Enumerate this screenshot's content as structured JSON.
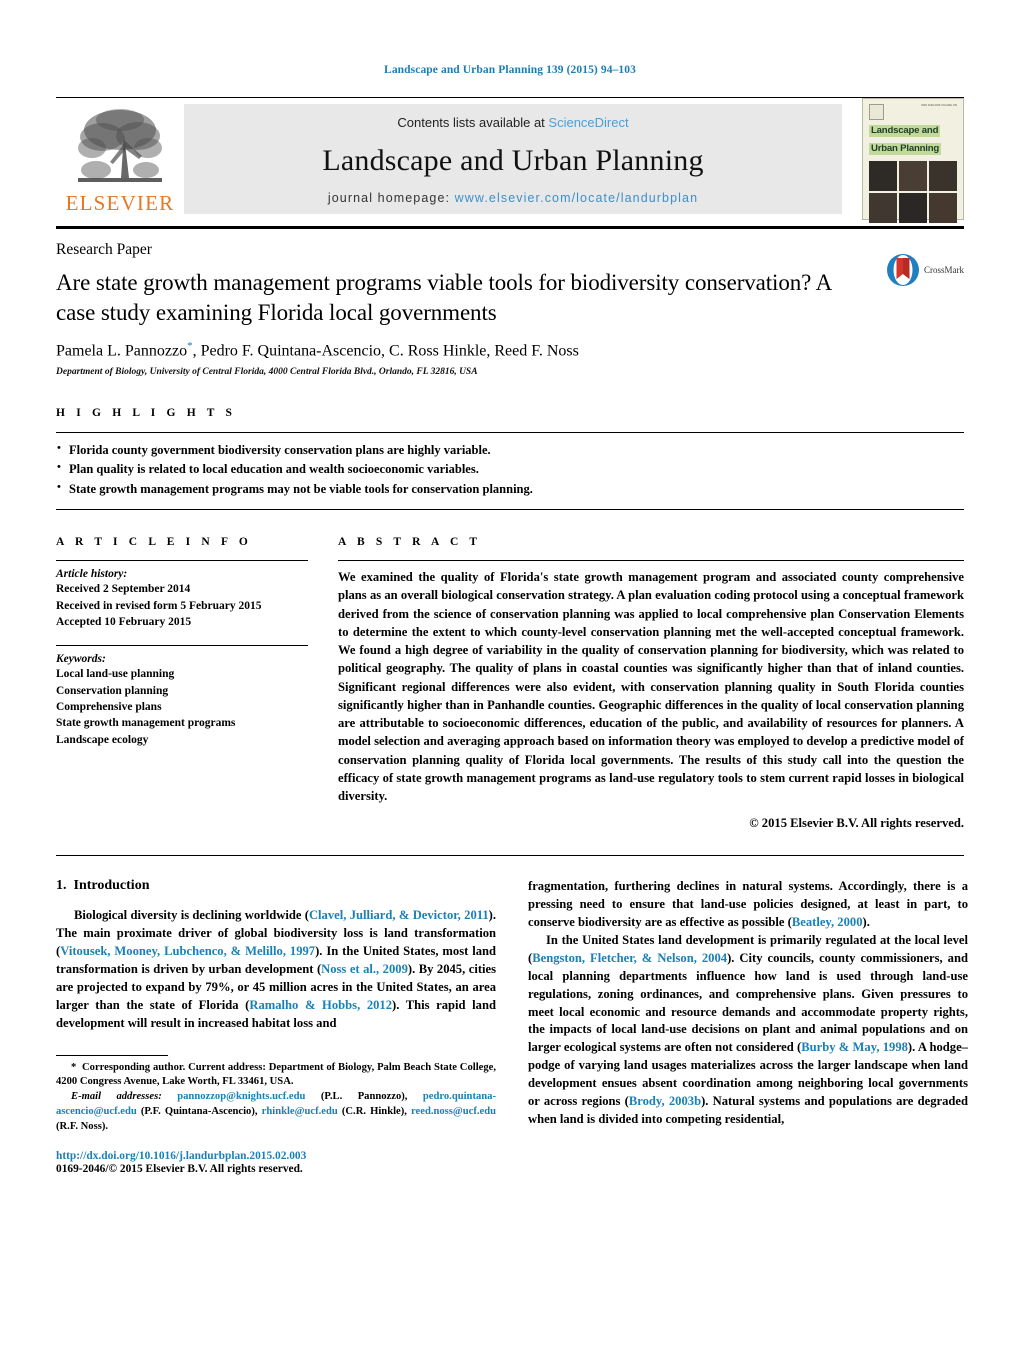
{
  "running_head": "Landscape and Urban Planning 139 (2015) 94–103",
  "masthead": {
    "contents_prefix": "Contents lists available at ",
    "contents_link": "ScienceDirect",
    "journal_title": "Landscape and Urban Planning",
    "homepage_prefix": "journal homepage: ",
    "homepage_url": "www.elsevier.com/locate/landurbplan",
    "publisher_wordmark": "ELSEVIER",
    "cover": {
      "line1": "Landscape and",
      "line2": "Urban Planning",
      "issn_text": "ISSN 0169-2046\nVOLUME 139"
    }
  },
  "article": {
    "type": "Research Paper",
    "title": "Are state growth management programs viable tools for biodiversity conservation? A case study examining Florida local governments",
    "authors": "Pamela L. Pannozzo, Pedro F. Quintana-Ascencio, C. Ross Hinkle, Reed F. Noss",
    "author_marker": "*",
    "affiliation": "Department of Biology, University of Central Florida, 4000 Central Florida Blvd., Orlando, FL 32816, USA",
    "crossmark_label": "CrossMark"
  },
  "highlights": {
    "label": "H I G H L I G H T S",
    "items": [
      "Florida county government biodiversity conservation plans are highly variable.",
      "Plan quality is related to local education and wealth socioeconomic variables.",
      "State growth management programs may not be viable tools for conservation planning."
    ]
  },
  "article_info": {
    "label": "A R T I C L E   I N F O",
    "history_label": "Article history:",
    "history": [
      "Received 2 September 2014",
      "Received in revised form 5 February 2015",
      "Accepted 10 February 2015"
    ],
    "keywords_label": "Keywords:",
    "keywords": [
      "Local land-use planning",
      "Conservation planning",
      "Comprehensive plans",
      "State growth management programs",
      "Landscape ecology"
    ]
  },
  "abstract": {
    "label": "A B S T R A C T",
    "text": "We examined the quality of Florida's state growth management program and associated county comprehensive plans as an overall biological conservation strategy. A plan evaluation coding protocol using a conceptual framework derived from the science of conservation planning was applied to local comprehensive plan Conservation Elements to determine the extent to which county-level conservation planning met the well-accepted conceptual framework. We found a high degree of variability in the quality of conservation planning for biodiversity, which was related to political geography. The quality of plans in coastal counties was significantly higher than that of inland counties. Significant regional differences were also evident, with conservation planning quality in South Florida counties significantly higher than in Panhandle counties. Geographic differences in the quality of local conservation planning are attributable to socioeconomic differences, education of the public, and availability of resources for planners. A model selection and averaging approach based on information theory was employed to develop a predictive model of conservation planning quality of Florida local governments. The results of this study call into the question the efficacy of state growth management programs as land-use regulatory tools to stem current rapid losses in biological diversity.",
    "copyright": "© 2015 Elsevier B.V. All rights reserved."
  },
  "introduction": {
    "number": "1.",
    "heading": "Introduction",
    "left_paragraph_parts": [
      "Biological diversity is declining worldwide (",
      "Clavel, Julliard, & Devictor, 2011",
      "). The main proximate driver of global biodiversity loss is land transformation (",
      "Vitousek, Mooney, Lubchenco, & Melillo, 1997",
      "). In the United States, most land transformation is driven by urban development (",
      "Noss et al., 2009",
      "). By 2045, cities are projected to expand by 79%, or 45 million acres in the United States, an area larger than the state of Florida (",
      "Ramalho & Hobbs, 2012",
      "). This rapid land development will result in increased habitat loss and"
    ],
    "right_paragraph1_parts": [
      "fragmentation, furthering declines in natural systems. Accordingly, there is a pressing need to ensure that land-use policies designed, at least in part, to conserve biodiversity are as effective as possible (",
      "Beatley, 2000",
      ")."
    ],
    "right_paragraph2_parts": [
      "In the United States land development is primarily regulated at the local level (",
      "Bengston, Fletcher, & Nelson, 2004",
      "). City councils, county commissioners, and local planning departments influence how land is used through land-use regulations, zoning ordinances, and comprehensive plans. Given pressures to meet local economic and resource demands and accommodate property rights, the impacts of local land-use decisions on plant and animal populations and on larger ecological systems are often not considered (",
      "Burby & May, 1998",
      "). A hodge–podge of varying land usages materializes across the larger landscape when land development ensues absent coordination among neighboring local governments or across regions (",
      "Brody, 2003b",
      "). Natural systems and populations are degraded when land is divided into competing residential,"
    ]
  },
  "footnotes": {
    "corresponding_marker": "*",
    "corresponding_text": "Corresponding author. Current address: Department of Biology, Palm Beach State College, 4200 Congress Avenue, Lake Worth, FL 33461, USA.",
    "email_label": "E-mail addresses:",
    "emails": [
      {
        "address": "pannozzop@knights.ucf.edu",
        "owner": "(P.L. Pannozzo),"
      },
      {
        "address": "pedro.quintana-ascencio@ucf.edu",
        "owner": "(P.F. Quintana-Ascencio),"
      },
      {
        "address": "rhinkle@ucf.edu",
        "owner": "(C.R. Hinkle),"
      },
      {
        "address": "reed.noss@ucf.edu",
        "owner": "(R.F. Noss)."
      }
    ],
    "doi": "http://dx.doi.org/10.1016/j.landurbplan.2015.02.003",
    "issn_line": "0169-2046/© 2015 Elsevier B.V. All rights reserved."
  },
  "colors": {
    "link_blue": "#1a80b8",
    "sciencedirect_blue": "#4a9fd4",
    "elsevier_orange": "#E87722",
    "masthead_grey": "#e8e8e8",
    "cover_cream": "#f2f0e0",
    "cover_green": "#c3d89b"
  }
}
